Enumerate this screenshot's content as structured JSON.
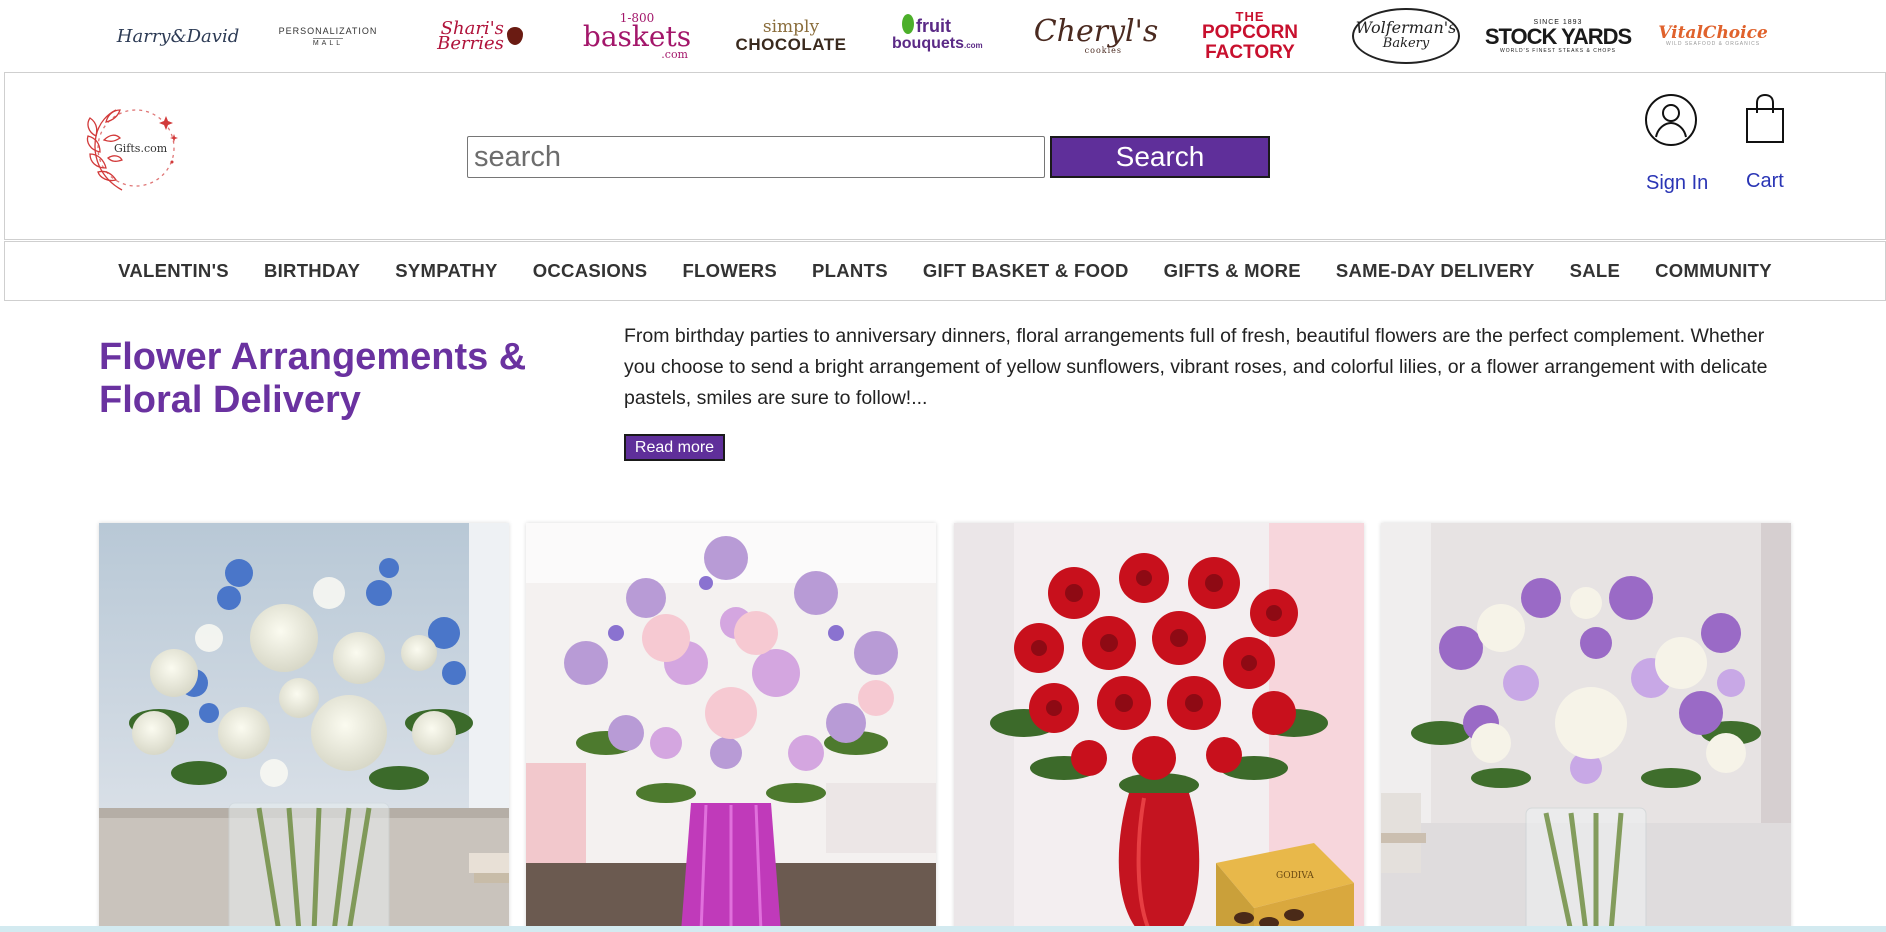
{
  "brands": {
    "harry_david": "Harry&David",
    "personalization_mall": [
      "PERSONALIZATION",
      "MALL"
    ],
    "sharis_berries": [
      "Shari's",
      "Berries"
    ],
    "baskets_1800": [
      "1-800",
      "baskets",
      ".com"
    ],
    "simply_chocolate": [
      "simply",
      "CHOCOLATE"
    ],
    "fruit_bouquets": [
      "fruit",
      "bouquets",
      ".com"
    ],
    "cheryls": [
      "Cheryl's",
      "cookies"
    ],
    "popcorn_factory": [
      "THE",
      "POPCORN",
      "FACTORY"
    ],
    "wolfermans": [
      "Wolferman's",
      "Bakery"
    ],
    "stock_yards": [
      "SINCE 1893",
      "STOCK YARDS",
      "WORLD'S FINEST STEAKS & CHOPS"
    ],
    "vital_choice": [
      "VitalChoice",
      "WILD SEAFOOD & ORGANICS"
    ]
  },
  "header": {
    "logo_text": "Gifts.com",
    "search_placeholder": "search",
    "search_button": "Search",
    "sign_in": "Sign In",
    "cart": "Cart"
  },
  "nav": {
    "items": [
      "VALENTIN'S",
      "BIRTHDAY",
      "SYMPATHY",
      "OCCASIONS",
      "FLOWERS",
      "PLANTS",
      "GIFT BASKET & FOOD",
      "GIFTS & MORE",
      "SAME-DAY DELIVERY",
      "SALE",
      "COMMUNITY"
    ]
  },
  "intro": {
    "title": "Flower Arrangements & Floral Delivery",
    "description": "From birthday parties to anniversary dinners, floral arrangements full of fresh, beautiful flowers are the perfect complement. Whether you choose to send a bright arrangement of yellow sunflowers, vibrant roses, and colorful lilies, or a flower arrangement with delicate pastels, smiles are sure to follow!...",
    "read_more": "Read more"
  },
  "products": [
    {
      "image": "white-and-blue-bouquet-in-glass-vase"
    },
    {
      "image": "pink-and-lavender-bouquet-in-pink-vase"
    },
    {
      "image": "red-roses-in-red-vase-with-chocolates",
      "box_text": "GODIVA"
    },
    {
      "image": "white-and-purple-bouquet-in-glass-vase"
    }
  ],
  "colors": {
    "brand_purple": "#5f2f9a",
    "title_purple": "#6a32a0",
    "link_blue": "#2a35b5"
  }
}
